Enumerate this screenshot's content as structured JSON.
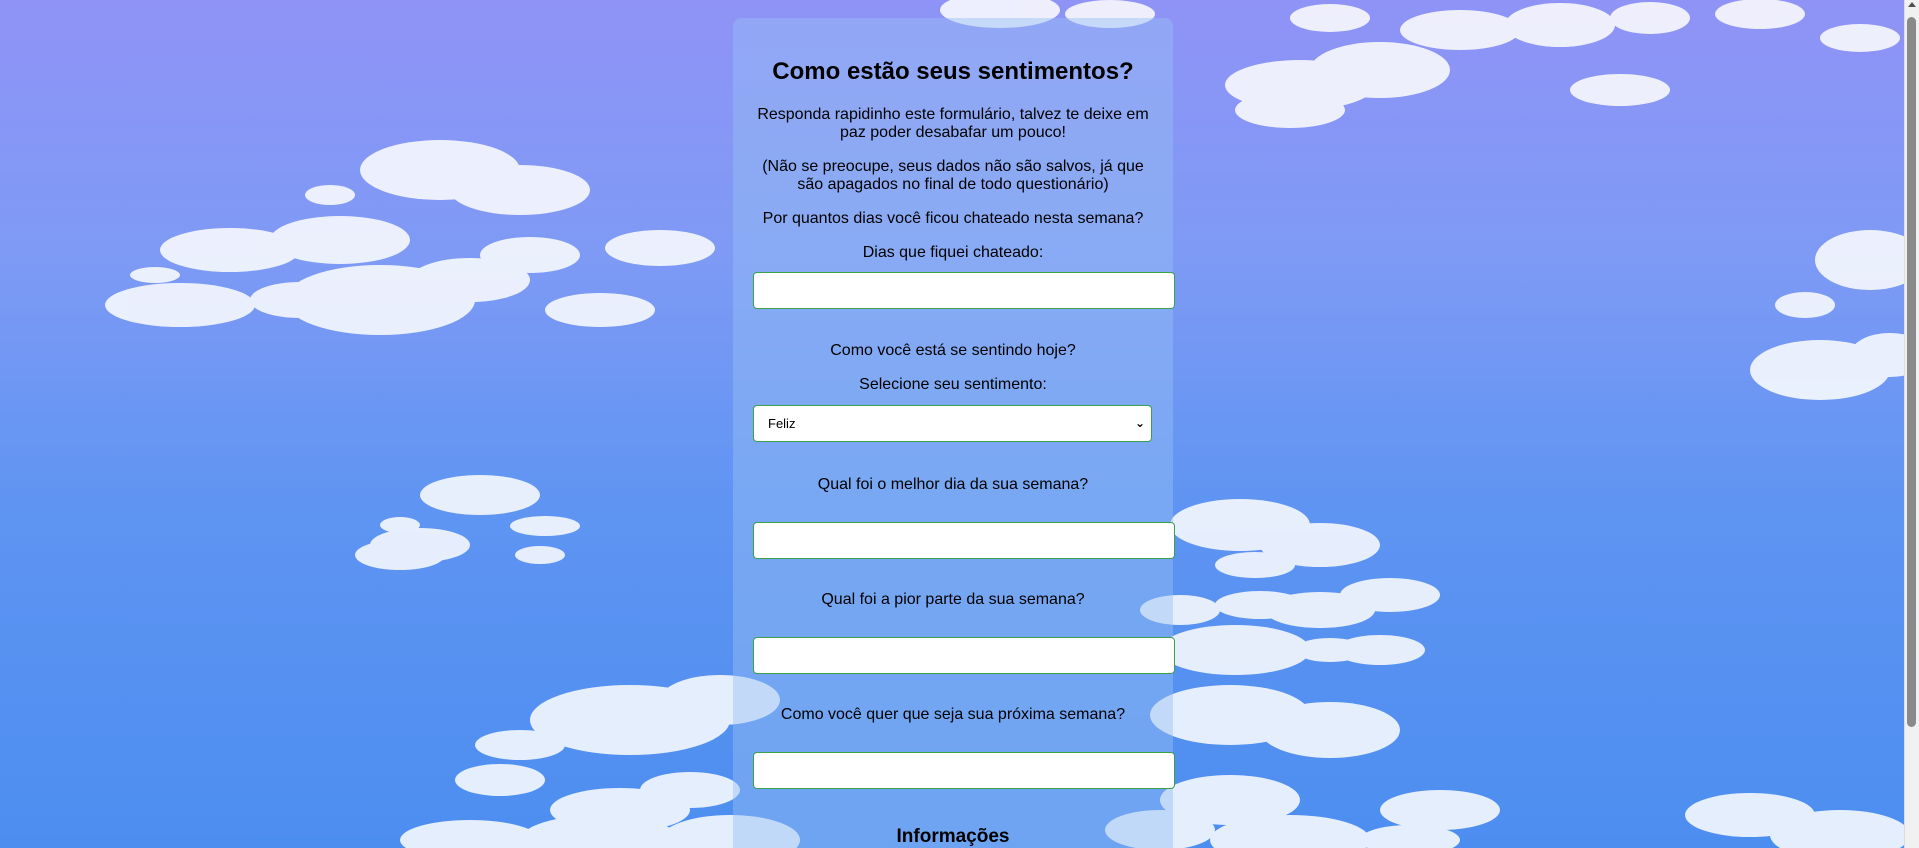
{
  "form": {
    "title": "Como estão seus sentimentos?",
    "intro": "Responda rapidinho este formulário, talvez te deixe em paz poder desabafar um pouco!",
    "privacy_note": "(Não se preocupe, seus dados não são salvos, já que são apagados no final de todo questionário)",
    "q1": {
      "question": "Por quantos dias você ficou chateado nesta semana?",
      "label": "Dias que fiquei chateado:",
      "value": ""
    },
    "q2": {
      "question": "Como você está se sentindo hoje?",
      "label": "Selecione seu sentimento:",
      "selected": "Feliz"
    },
    "q3": {
      "question": "Qual foi o melhor dia da sua semana?",
      "value": ""
    },
    "q4": {
      "question": "Qual foi a pior parte da sua semana?",
      "value": ""
    },
    "q5": {
      "question": "Como você quer que seja sua próxima semana?",
      "value": ""
    },
    "section_heading": "Informações"
  },
  "colors": {
    "sky_top": "#8f93f6",
    "sky_bottom": "#4c8ef0",
    "field_border": "#3aa04a"
  },
  "icons": {
    "select_arrow": "chevron-down-icon"
  }
}
